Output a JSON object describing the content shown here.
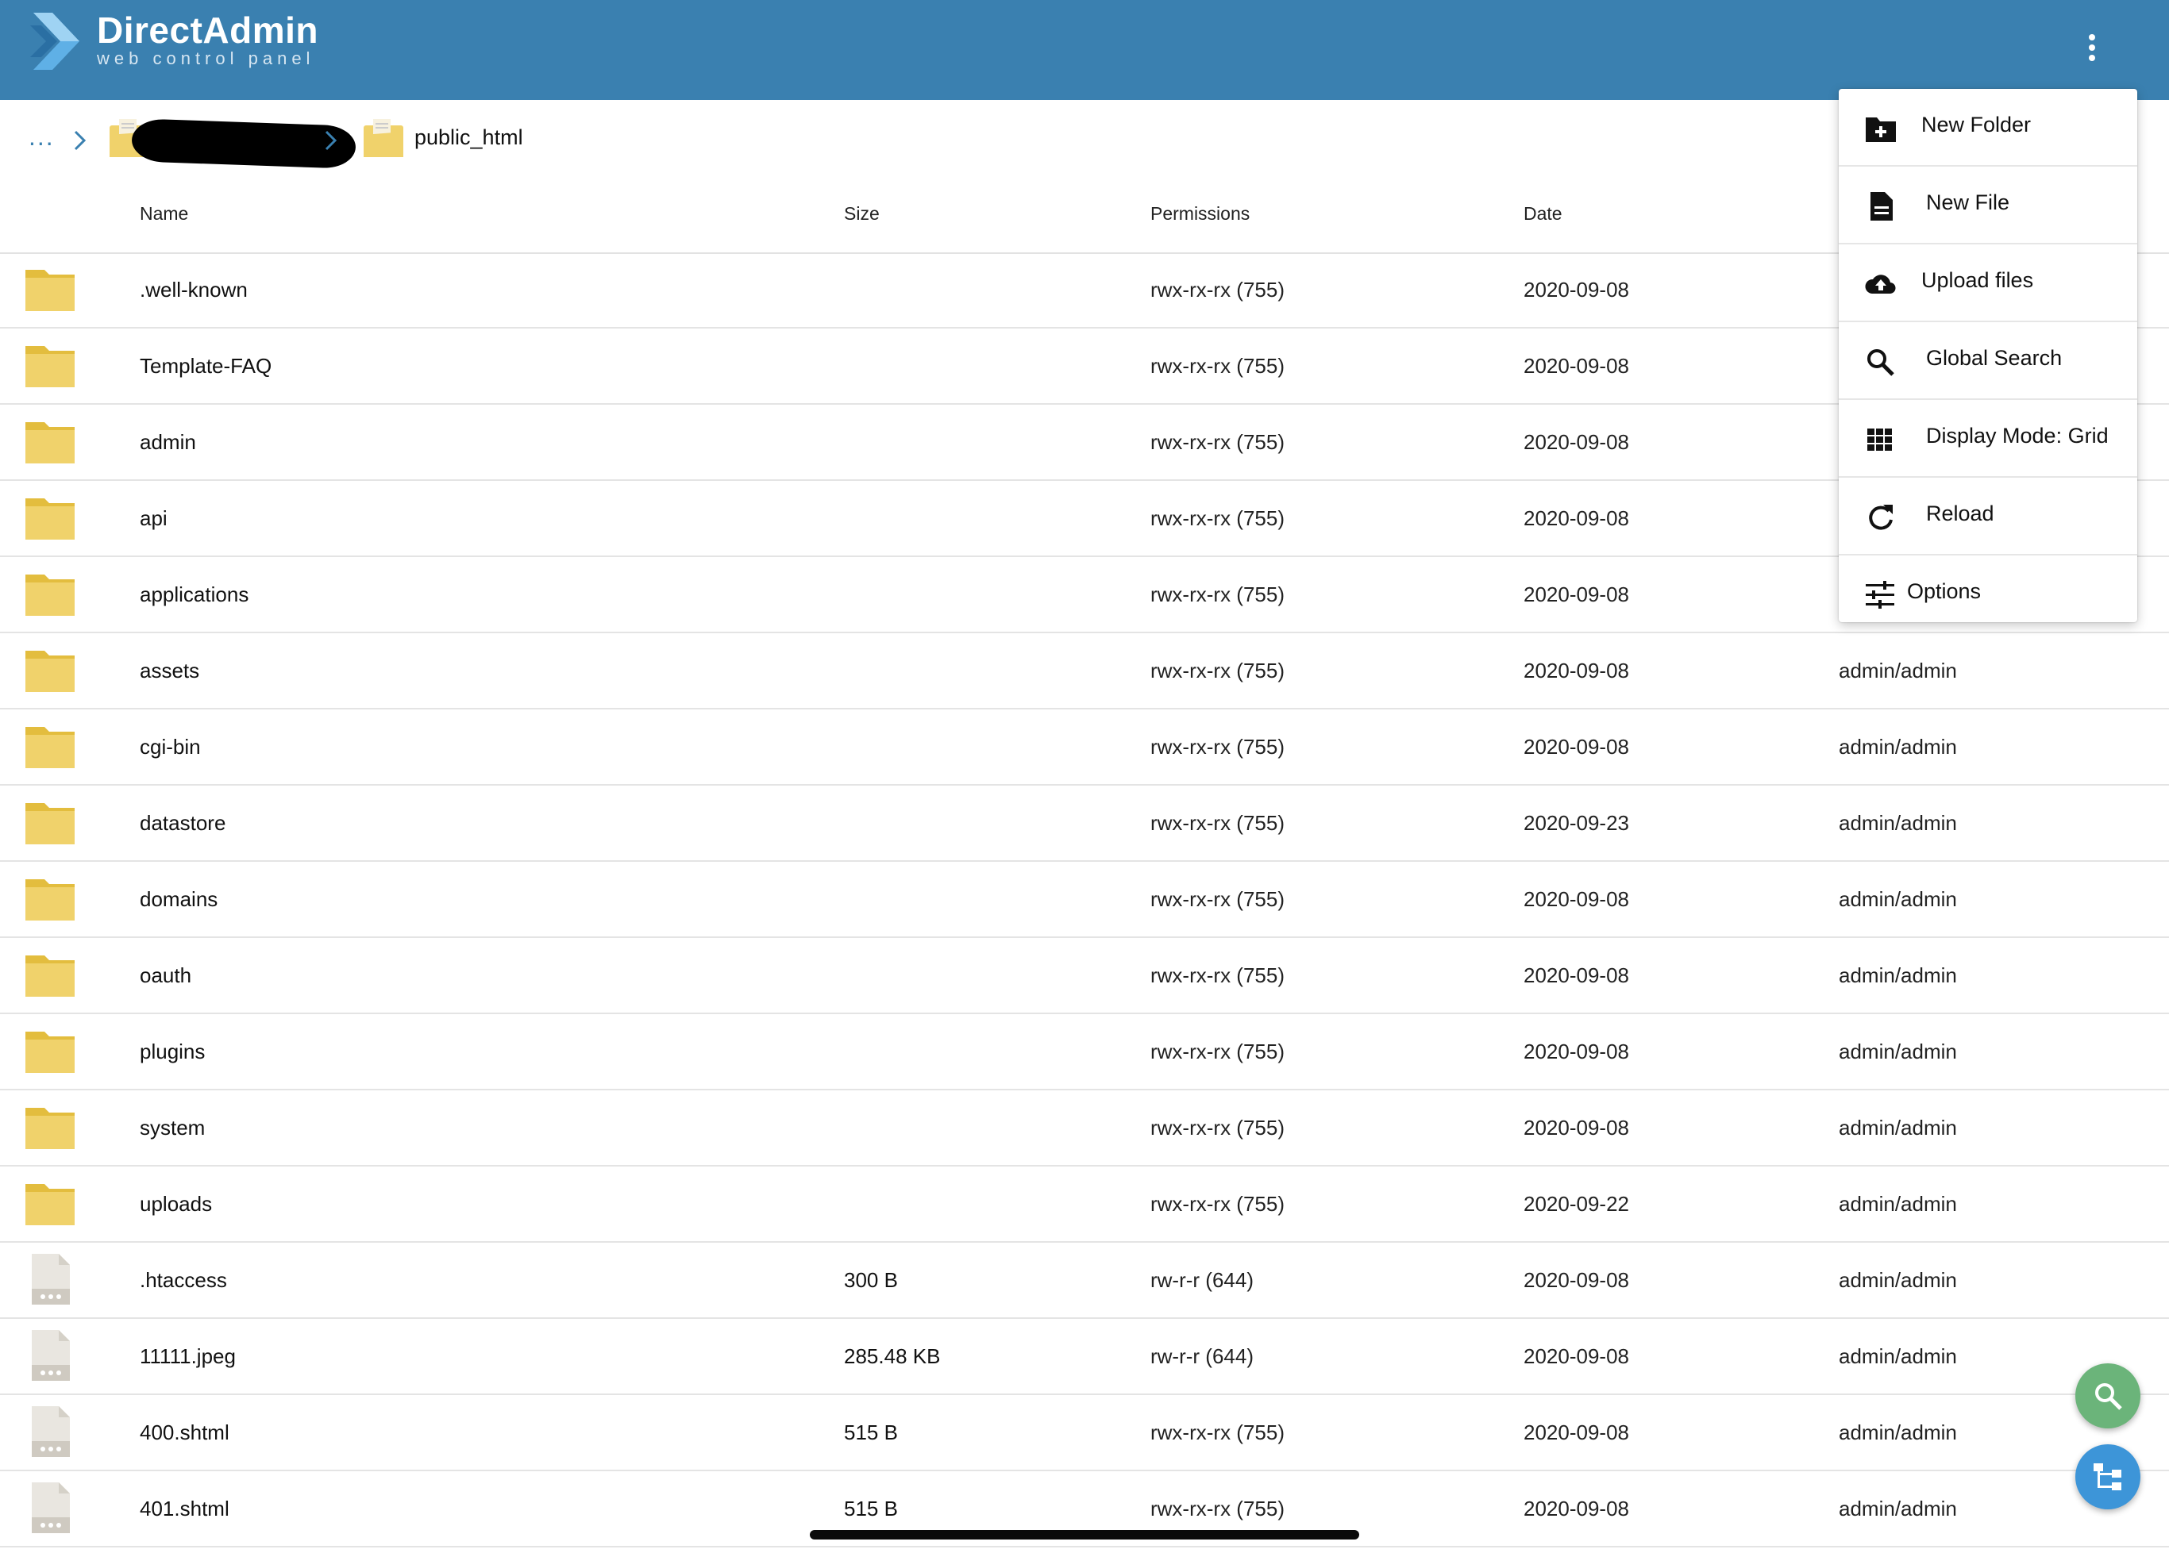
{
  "header": {
    "brand_name": "DirectAdmin",
    "brand_subtitle": "web control panel",
    "menu_icon": "more-vertical-icon",
    "color": "#3a80b0"
  },
  "breadcrumb": {
    "more": "...",
    "current": "public_html"
  },
  "table": {
    "columns": {
      "name": "Name",
      "size": "Size",
      "permissions": "Permissions",
      "date": "Date"
    },
    "rows": [
      {
        "type": "folder",
        "name": ".well-known",
        "size": "",
        "permissions": "rwx-rx-rx (755)",
        "date": "2020-09-08",
        "owner": ""
      },
      {
        "type": "folder",
        "name": "Template-FAQ",
        "size": "",
        "permissions": "rwx-rx-rx (755)",
        "date": "2020-09-08",
        "owner": ""
      },
      {
        "type": "folder",
        "name": "admin",
        "size": "",
        "permissions": "rwx-rx-rx (755)",
        "date": "2020-09-08",
        "owner": ""
      },
      {
        "type": "folder",
        "name": "api",
        "size": "",
        "permissions": "rwx-rx-rx (755)",
        "date": "2020-09-08",
        "owner": ""
      },
      {
        "type": "folder",
        "name": "applications",
        "size": "",
        "permissions": "rwx-rx-rx (755)",
        "date": "2020-09-08",
        "owner": ""
      },
      {
        "type": "folder",
        "name": "assets",
        "size": "",
        "permissions": "rwx-rx-rx (755)",
        "date": "2020-09-08",
        "owner": "admin/admin"
      },
      {
        "type": "folder",
        "name": "cgi-bin",
        "size": "",
        "permissions": "rwx-rx-rx (755)",
        "date": "2020-09-08",
        "owner": "admin/admin"
      },
      {
        "type": "folder",
        "name": "datastore",
        "size": "",
        "permissions": "rwx-rx-rx (755)",
        "date": "2020-09-23",
        "owner": "admin/admin"
      },
      {
        "type": "folder",
        "name": "domains",
        "size": "",
        "permissions": "rwx-rx-rx (755)",
        "date": "2020-09-08",
        "owner": "admin/admin"
      },
      {
        "type": "folder",
        "name": "oauth",
        "size": "",
        "permissions": "rwx-rx-rx (755)",
        "date": "2020-09-08",
        "owner": "admin/admin"
      },
      {
        "type": "folder",
        "name": "plugins",
        "size": "",
        "permissions": "rwx-rx-rx (755)",
        "date": "2020-09-08",
        "owner": "admin/admin"
      },
      {
        "type": "folder",
        "name": "system",
        "size": "",
        "permissions": "rwx-rx-rx (755)",
        "date": "2020-09-08",
        "owner": "admin/admin"
      },
      {
        "type": "folder",
        "name": "uploads",
        "size": "",
        "permissions": "rwx-rx-rx (755)",
        "date": "2020-09-22",
        "owner": "admin/admin"
      },
      {
        "type": "file",
        "name": ".htaccess",
        "size": "300 B",
        "permissions": "rw-r-r (644)",
        "date": "2020-09-08",
        "owner": "admin/admin"
      },
      {
        "type": "file",
        "name": "11111.jpeg",
        "size": "285.48 KB",
        "permissions": "rw-r-r (644)",
        "date": "2020-09-08",
        "owner": "admin/admin"
      },
      {
        "type": "file",
        "name": "400.shtml",
        "size": "515 B",
        "permissions": "rwx-rx-rx (755)",
        "date": "2020-09-08",
        "owner": "admin/admin"
      },
      {
        "type": "file",
        "name": "401.shtml",
        "size": "515 B",
        "permissions": "rwx-rx-rx (755)",
        "date": "2020-09-08",
        "owner": "admin/admin"
      }
    ]
  },
  "menu": {
    "items": [
      {
        "label": "New Folder",
        "icon": "new-folder-icon"
      },
      {
        "label": "New File",
        "icon": "new-file-icon"
      },
      {
        "label": "Upload files",
        "icon": "cloud-upload-icon"
      },
      {
        "label": "Global Search",
        "icon": "search-icon"
      },
      {
        "label": "Display Mode: Grid",
        "icon": "grid-icon"
      },
      {
        "label": "Reload",
        "icon": "reload-icon"
      },
      {
        "label": "Options",
        "icon": "sliders-icon"
      }
    ]
  },
  "fabs": {
    "search": {
      "icon": "search-icon",
      "color": "#6bb47a"
    },
    "tree": {
      "icon": "tree-icon",
      "color": "#3d95d8"
    }
  },
  "colors": {
    "folder": "#f0d26b",
    "folder_tab": "#e3bd3e",
    "accent": "#3a80b0"
  }
}
